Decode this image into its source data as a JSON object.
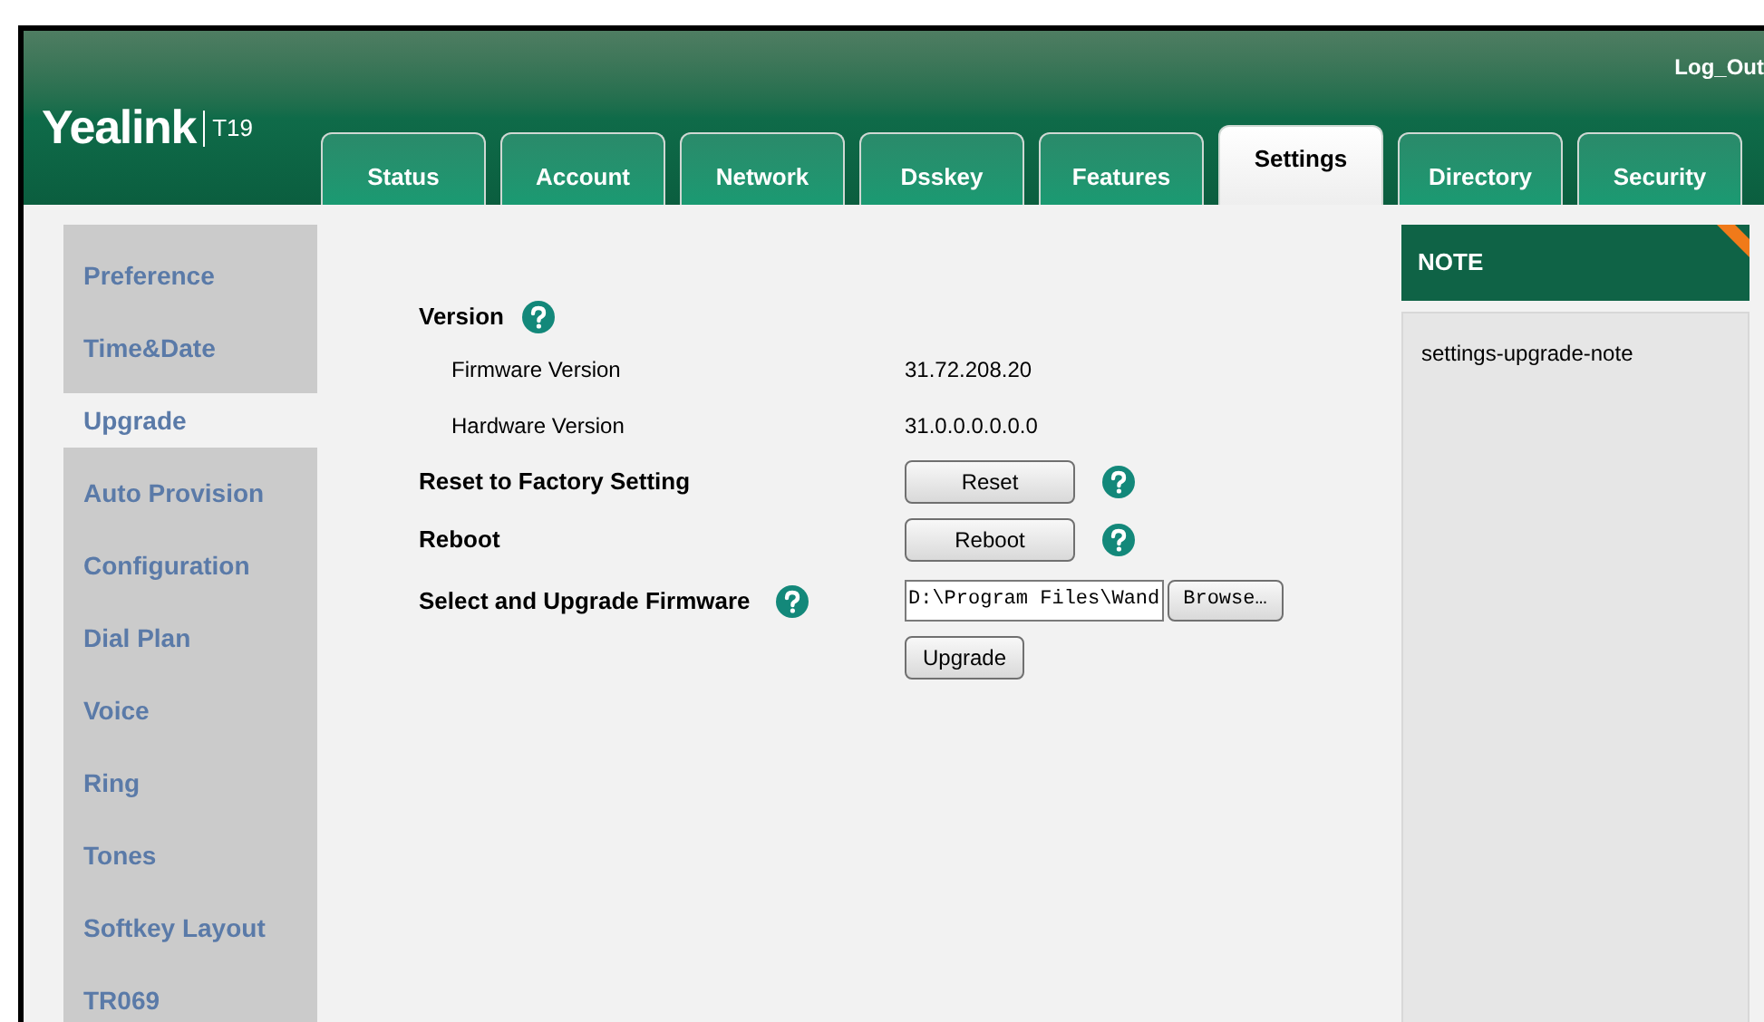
{
  "header": {
    "logo": "Yealink",
    "model": "T19",
    "logout": "Log_Out"
  },
  "tabs": [
    {
      "label": "Status",
      "selected": false
    },
    {
      "label": "Account",
      "selected": false
    },
    {
      "label": "Network",
      "selected": false
    },
    {
      "label": "Dsskey",
      "selected": false
    },
    {
      "label": "Features",
      "selected": false
    },
    {
      "label": "Settings",
      "selected": true
    },
    {
      "label": "Directory",
      "selected": false
    },
    {
      "label": "Security",
      "selected": false
    }
  ],
  "sidebar": {
    "items": [
      {
        "label": "Preference",
        "selected": false
      },
      {
        "label": "Time&Date",
        "selected": false
      },
      {
        "label": "Upgrade",
        "selected": true
      },
      {
        "label": "Auto Provision",
        "selected": false
      },
      {
        "label": "Configuration",
        "selected": false
      },
      {
        "label": "Dial Plan",
        "selected": false
      },
      {
        "label": "Voice",
        "selected": false
      },
      {
        "label": "Ring",
        "selected": false
      },
      {
        "label": "Tones",
        "selected": false
      },
      {
        "label": "Softkey Layout",
        "selected": false
      },
      {
        "label": "TR069",
        "selected": false
      }
    ]
  },
  "rows": [
    {
      "kind": "heading",
      "label": "Version",
      "help": true
    },
    {
      "kind": "value",
      "label": "Firmware Version",
      "value": "31.72.208.20"
    },
    {
      "kind": "value",
      "label": "Hardware Version",
      "value": "31.0.0.0.0.0.0"
    },
    {
      "kind": "button",
      "label": "Reset to Factory Setting",
      "button": "Reset",
      "help": true
    },
    {
      "kind": "button",
      "label": "Reboot",
      "button": "Reboot",
      "help": true
    },
    {
      "kind": "file",
      "label": "Select and Upgrade Firmware",
      "help": true,
      "file_value": "D:\\Program Files\\Wand",
      "browse": "Browse…",
      "button": "Upgrade"
    }
  ],
  "note": {
    "title": "NOTE",
    "text": "settings-upgrade-note"
  }
}
